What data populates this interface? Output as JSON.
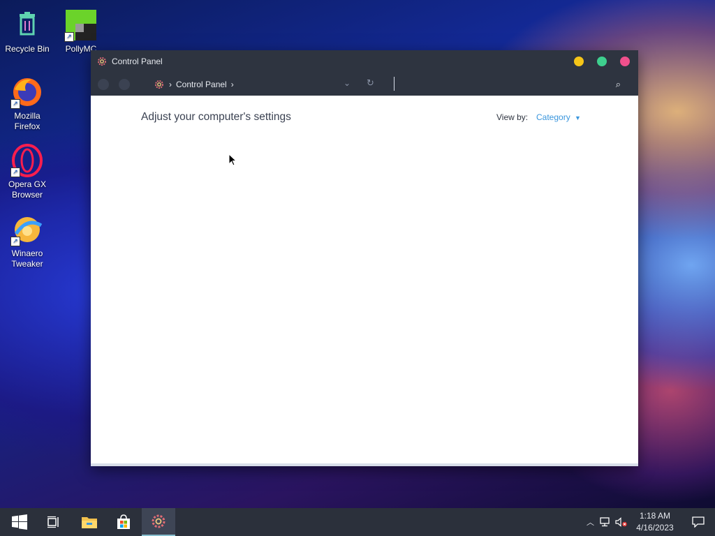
{
  "desktop": {
    "icons": [
      {
        "label": "Recycle Bin",
        "icon": "recycle-bin-icon"
      },
      {
        "label": "PollyMC",
        "icon": "pollymc-icon"
      },
      {
        "label": "Mozilla Firefox",
        "icon": "firefox-icon"
      },
      {
        "label": "Opera GX Browser",
        "icon": "opera-gx-icon"
      },
      {
        "label": "Winaero Tweaker",
        "icon": "winaero-tweaker-icon"
      }
    ]
  },
  "window": {
    "title": "Control Panel",
    "breadcrumb": [
      "Control Panel"
    ],
    "heading": "Adjust your computer's settings",
    "view_by_label": "View by:",
    "view_by_value": "Category",
    "buttons": {
      "minimize_color": "#f5c518",
      "maximize_color": "#3ecf8e",
      "close_color": "#f0508c"
    }
  },
  "taskbar": {
    "items": [
      "start-icon",
      "task-view-icon",
      "file-explorer-icon",
      "microsoft-store-icon",
      "control-panel-icon"
    ],
    "tray": {
      "time": "1:18 AM",
      "date": "4/16/2023"
    }
  },
  "colors": {
    "accent": "#3a96dd",
    "titlebar": "#2e3440"
  }
}
